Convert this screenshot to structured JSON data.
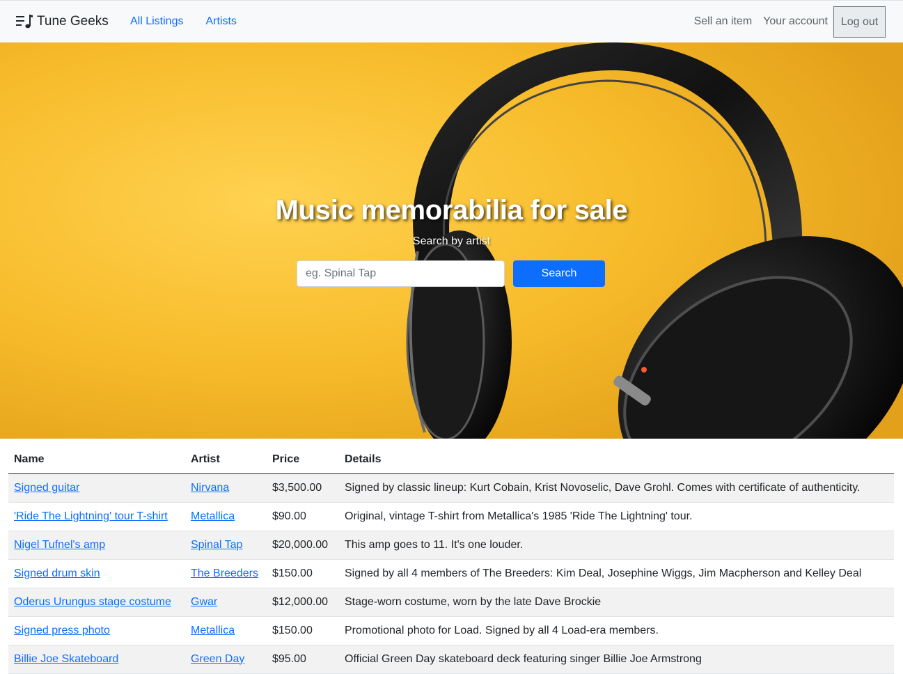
{
  "navbar": {
    "brand": "Tune Geeks",
    "brand_icon": "music-list-icon",
    "links": [
      "All Listings",
      "Artists"
    ],
    "right_links": [
      "Sell an item",
      "Your account"
    ],
    "logout_label": "Log out"
  },
  "hero": {
    "title": "Music memorabilia for sale",
    "subtitle": "Search by artist",
    "search_placeholder": "eg. Spinal Tap",
    "search_value": "",
    "search_button": "Search",
    "background_color": "#f8bd2c"
  },
  "table": {
    "headers": [
      "Name",
      "Artist",
      "Price",
      "Details"
    ],
    "rows": [
      {
        "name": "Signed guitar",
        "artist": "Nirvana",
        "price": "$3,500.00",
        "details": "Signed by classic lineup: Kurt Cobain, Krist Novoselic, Dave Grohl. Comes with certificate of authenticity."
      },
      {
        "name": "'Ride The Lightning' tour T-shirt",
        "artist": "Metallica",
        "price": "$90.00",
        "details": "Original, vintage T-shirt from Metallica's 1985 'Ride The Lightning' tour."
      },
      {
        "name": "Nigel Tufnel's amp",
        "artist": "Spinal Tap",
        "price": "$20,000.00",
        "details": "This amp goes to 11. It's one louder."
      },
      {
        "name": "Signed drum skin",
        "artist": "The Breeders",
        "price": "$150.00",
        "details": "Signed by all 4 members of The Breeders: Kim Deal, Josephine Wiggs, Jim Macpherson and Kelley Deal"
      },
      {
        "name": "Oderus Urungus stage costume",
        "artist": "Gwar",
        "price": "$12,000.00",
        "details": "Stage-worn costume, worn by the late Dave Brockie"
      },
      {
        "name": "Signed press photo",
        "artist": "Metallica",
        "price": "$150.00",
        "details": "Promotional photo for Load. Signed by all 4 Load-era members."
      },
      {
        "name": "Billie Joe Skateboard",
        "artist": "Green Day",
        "price": "$95.00",
        "details": "Official Green Day skateboard deck featuring singer Billie Joe Armstrong"
      }
    ]
  },
  "colors": {
    "link": "#0d6efd",
    "primary_button": "#0d6efd",
    "navbar_bg": "#f8f9fa",
    "striped_row": "#f2f2f2"
  }
}
